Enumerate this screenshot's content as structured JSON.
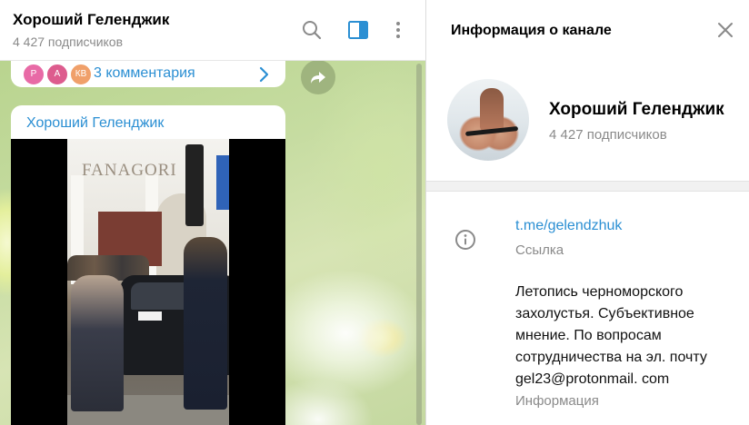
{
  "chat": {
    "title": "Хороший Геленджик",
    "subscribers": "4 427 подписчиков",
    "header_icons": [
      "search-icon",
      "sidebar-panel-icon",
      "more-vertical-icon"
    ],
    "comments": {
      "avatars": [
        {
          "initial": "Р",
          "color": "#e86aa6"
        },
        {
          "initial": "А",
          "color": "#dd5c8e"
        },
        {
          "initial": "КВ",
          "color": "#f0a06a"
        }
      ],
      "label": "3 комментария"
    },
    "post": {
      "author": "Хороший Геленджик",
      "video_sign": "FANAGORI"
    }
  },
  "info": {
    "title": "Информация о канале",
    "name": "Хороший Геленджик",
    "subscribers": "4 427 подписчиков",
    "link": "t.me/gelendzhuk",
    "link_label": "Ссылка",
    "description": "Летопись черноморского\nзахолустья. Субъективное\nмнение. По вопросам\nсотрудничества на эл. почту\ngel23@protonmail. com",
    "description_label": "Информация"
  },
  "colors": {
    "accent": "#2b8fd3",
    "muted": "#8a8a8a"
  }
}
